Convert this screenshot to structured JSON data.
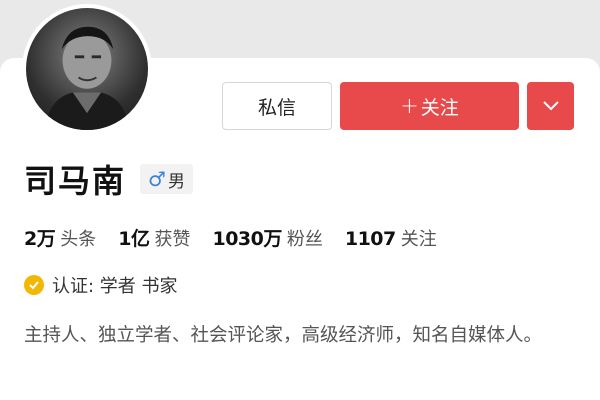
{
  "profile": {
    "name": "司马南",
    "gender": "男",
    "gender_icon": "male-icon",
    "avatar_icon": "avatar-photo"
  },
  "actions": {
    "message_label": "私信",
    "follow_label": "关注",
    "follow_prefix": "+",
    "more_icon": "chevron-down-icon"
  },
  "stats": [
    {
      "value": "2万",
      "label": "头条"
    },
    {
      "value": "1亿",
      "label": "获赞"
    },
    {
      "value": "1030万",
      "label": "粉丝"
    },
    {
      "value": "1107",
      "label": "关注"
    }
  ],
  "verification": {
    "text": "认证: 学者 书家",
    "icon": "verified-badge-icon",
    "icon_color": "#f2b705"
  },
  "bio": "主持人、独立学者、社会评论家，高级经济师，知名自媒体人。",
  "colors": {
    "accent": "#e8494a",
    "background": "#e9e9e9",
    "card": "#ffffff"
  }
}
